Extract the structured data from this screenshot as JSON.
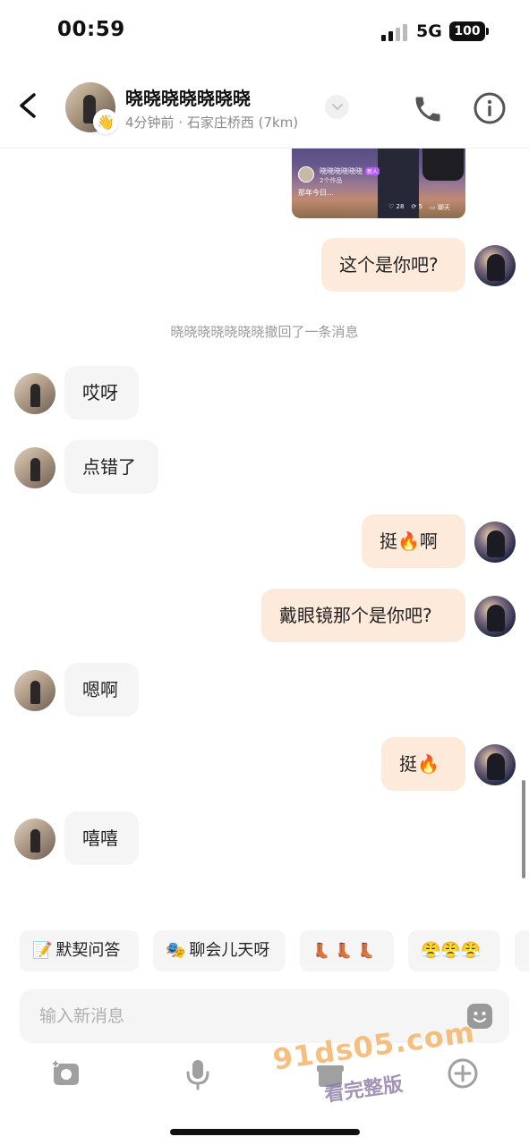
{
  "status_bar": {
    "time": "00:59",
    "network": "5G",
    "battery": "100"
  },
  "header": {
    "name": "晓晓晓晓晓晓晓",
    "subtitle": "4分钟前 · 石家庄桥西 (7km)"
  },
  "shared_card": {
    "user": "晓晓晓晓晓晓",
    "tag": "新人",
    "count": "2个作品",
    "caption": "那年今日...",
    "likes": "28",
    "shares": "5",
    "chat": "聊天"
  },
  "messages": [
    {
      "side": "out",
      "text": "这个是你吧?"
    },
    {
      "side": "in",
      "text": "哎呀"
    },
    {
      "side": "in",
      "text": "点错了"
    },
    {
      "side": "out",
      "text": "挺🔥啊"
    },
    {
      "side": "out",
      "text": "戴眼镜那个是你吧?"
    },
    {
      "side": "in",
      "text": "嗯啊"
    },
    {
      "side": "out",
      "text": "挺🔥"
    },
    {
      "side": "in",
      "text": "嘻嘻"
    }
  ],
  "system_message": "晓晓晓晓晓晓晓撤回了一条消息",
  "quick_replies": [
    {
      "icon": "📝",
      "label": "默契问答"
    },
    {
      "icon": "🎭",
      "label": "聊会儿天呀"
    },
    {
      "icon": "",
      "label": "👢 👢 👢"
    },
    {
      "icon": "",
      "label": "😤😤😤"
    }
  ],
  "input": {
    "placeholder": "输入新消息"
  },
  "watermark": {
    "line1": "91ds05.com",
    "line2": "看完整版"
  }
}
